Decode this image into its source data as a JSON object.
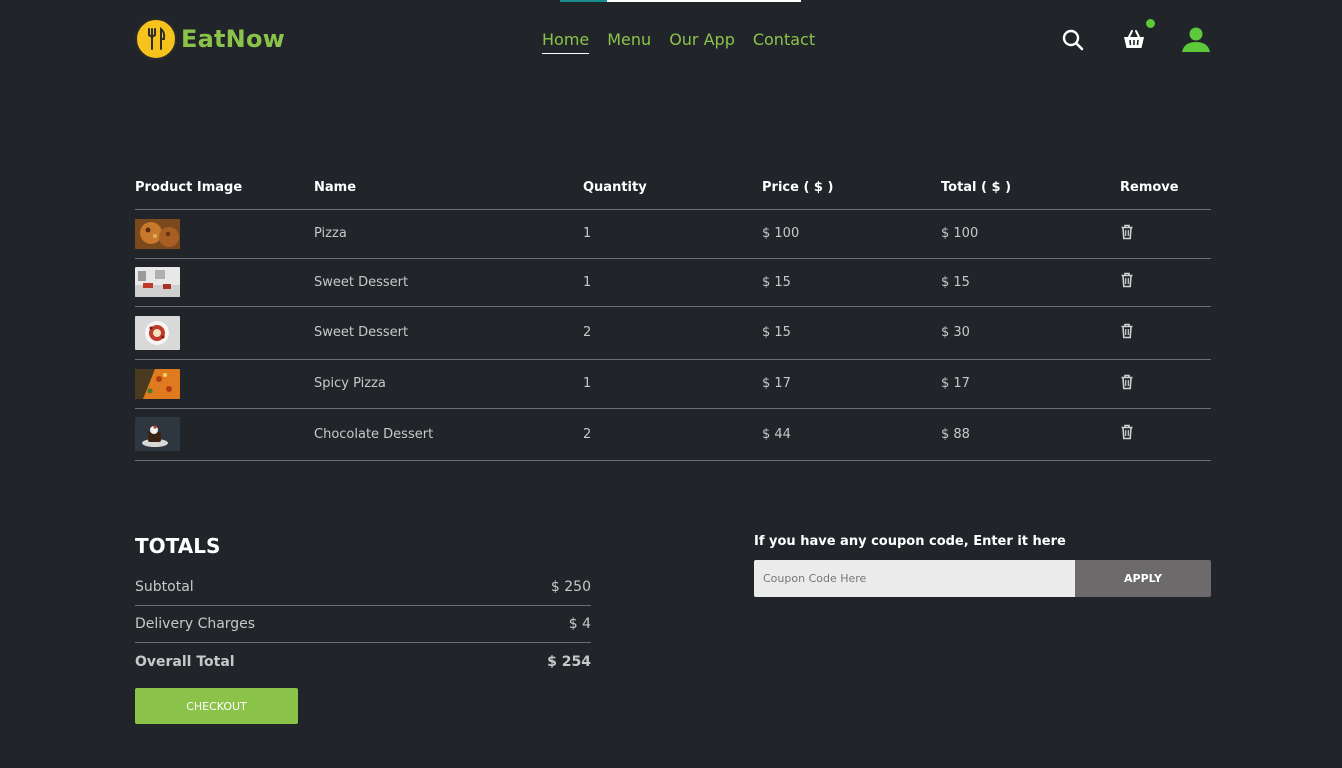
{
  "header": {
    "brand": "EatNow",
    "nav": [
      "Home",
      "Menu",
      "Our App",
      "Contact"
    ],
    "active_nav": "Home",
    "icons": [
      "search-icon",
      "cart-icon",
      "user-icon"
    ]
  },
  "colors": {
    "background": "#212529",
    "accent": "#8bc34a",
    "logo_badge": "#f6c21c",
    "apply_button": "#6c6a6a",
    "notification_dot": "#5cc83a"
  },
  "cart": {
    "columns": [
      "Product Image",
      "Name",
      "Quantity",
      "Price ( $ )",
      "Total ( $ )",
      "Remove"
    ],
    "rows": [
      {
        "image": "pizza",
        "name": "Pizza",
        "quantity": "1",
        "price": "$ 100",
        "total": "$ 100"
      },
      {
        "image": "dessert-restaurant",
        "name": "Sweet Dessert",
        "quantity": "1",
        "price": "$ 15",
        "total": "$ 15"
      },
      {
        "image": "dessert-plate",
        "name": "Sweet Dessert",
        "quantity": "2",
        "price": "$ 15",
        "total": "$ 30"
      },
      {
        "image": "spicy-pizza",
        "name": "Spicy Pizza",
        "quantity": "1",
        "price": "$ 17",
        "total": "$ 17"
      },
      {
        "image": "chocolate-dessert",
        "name": "Chocolate Dessert",
        "quantity": "2",
        "price": "$ 44",
        "total": "$ 88"
      }
    ]
  },
  "totals": {
    "title": "TOTALS",
    "subtotal_label": "Subtotal",
    "subtotal_value": "$ 250",
    "delivery_label": "Delivery Charges",
    "delivery_value": "$ 4",
    "overall_label": "Overall Total",
    "overall_value": "$ 254",
    "checkout_label": "CHECKOUT"
  },
  "coupon": {
    "label": "If you have any coupon code, Enter it here",
    "placeholder": "Coupon Code Here",
    "value": "",
    "apply_label": "APPLY"
  }
}
